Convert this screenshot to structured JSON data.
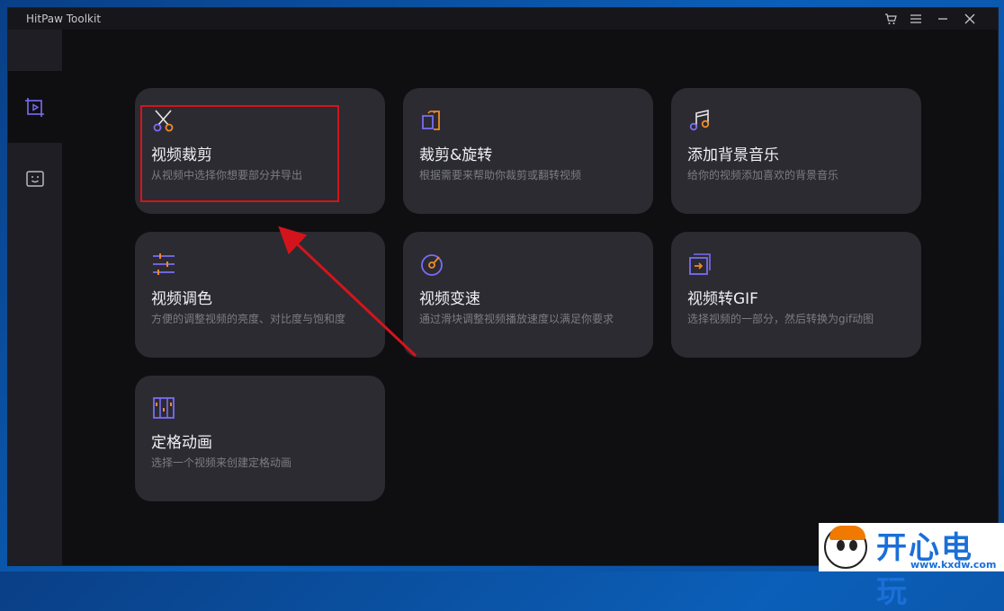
{
  "window": {
    "title": "HitPaw Toolkit"
  },
  "titlebar_icons": [
    "cart-icon",
    "menu-icon",
    "minimize-icon",
    "close-icon"
  ],
  "sidebar": {
    "items": [
      {
        "icon": "video-edit-icon",
        "active": true
      },
      {
        "icon": "face-icon",
        "active": false
      }
    ]
  },
  "cards": [
    {
      "title": "视频裁剪",
      "desc": "从视频中选择你想要部分并导出",
      "icon": "scissors-icon"
    },
    {
      "title": "裁剪&旋转",
      "desc": "根据需要来帮助你裁剪或翻转视频",
      "icon": "crop-rotate-icon"
    },
    {
      "title": "添加背景音乐",
      "desc": "给你的视频添加喜欢的背景音乐",
      "icon": "music-note-icon"
    },
    {
      "title": "视频调色",
      "desc": "方便的调整视频的亮度、对比度与饱和度",
      "icon": "sliders-icon"
    },
    {
      "title": "视频变速",
      "desc": "通过滑块调整视频播放速度以满足你要求",
      "icon": "speedometer-icon"
    },
    {
      "title": "视频转GIF",
      "desc": "选择视频的一部分，然后转换为gif动图",
      "icon": "gif-convert-icon"
    },
    {
      "title": "定格动画",
      "desc": "选择一个视频来创建定格动画",
      "icon": "film-frames-icon"
    }
  ],
  "watermark": {
    "text": "开心电玩",
    "url": "www.kxdw.com"
  },
  "colors": {
    "accent_purple": "#7b6cf6",
    "accent_orange": "#f08a2a",
    "highlight_red": "#d4141c"
  }
}
